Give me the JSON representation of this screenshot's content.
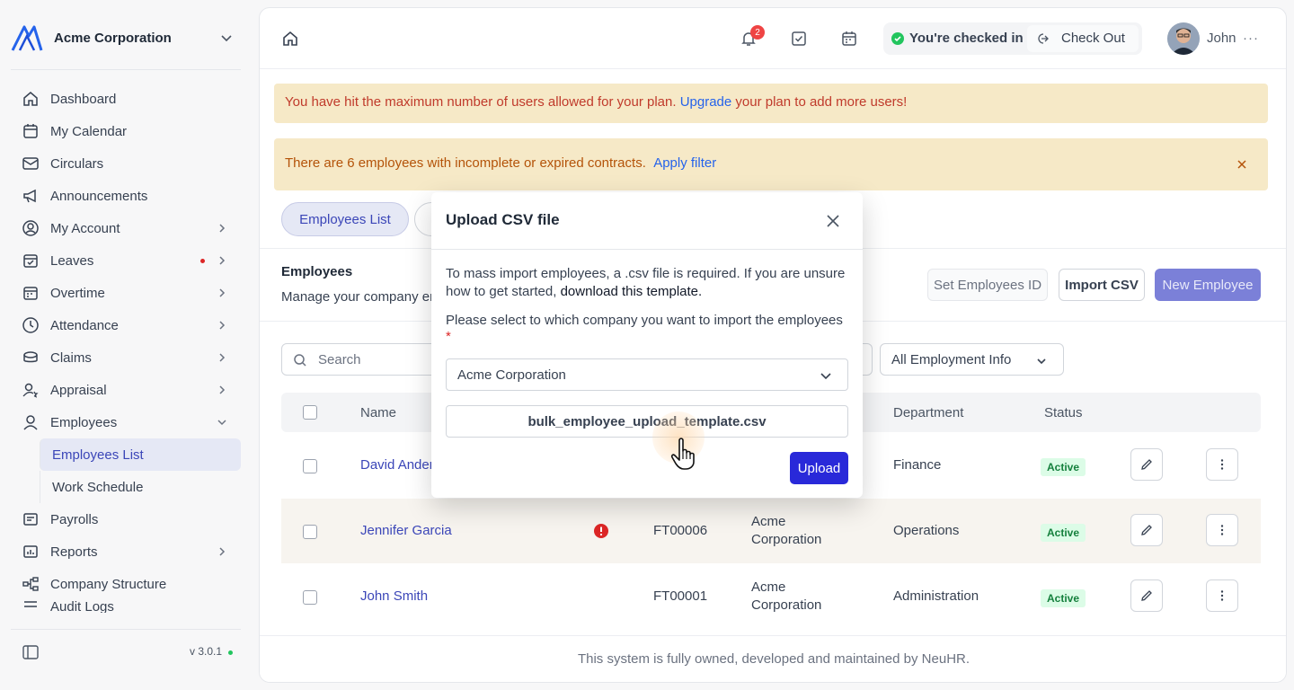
{
  "brand": {
    "name": "Acme Corporation"
  },
  "sidebar": {
    "items": [
      {
        "label": "Dashboard",
        "icon": "home-icon"
      },
      {
        "label": "My Calendar",
        "icon": "calendar-icon"
      },
      {
        "label": "Circulars",
        "icon": "mail-icon"
      },
      {
        "label": "Announcements",
        "icon": "megaphone-icon"
      },
      {
        "label": "My Account",
        "icon": "user-circle-icon"
      },
      {
        "label": "Leaves",
        "icon": "calendar-check-icon"
      },
      {
        "label": "Overtime",
        "icon": "calendar-clock-icon"
      },
      {
        "label": "Attendance",
        "icon": "clock-icon"
      },
      {
        "label": "Claims",
        "icon": "coins-icon"
      },
      {
        "label": "Appraisal",
        "icon": "user-star-icon"
      },
      {
        "label": "Employees",
        "icon": "user-icon"
      },
      {
        "label": "Payrolls",
        "icon": "receipt-icon"
      },
      {
        "label": "Reports",
        "icon": "chart-icon"
      },
      {
        "label": "Company Structure",
        "icon": "hierarchy-icon"
      },
      {
        "label": "Audit Logs",
        "icon": "list-icon"
      }
    ],
    "employees_sub": [
      {
        "label": "Employees List",
        "active": true
      },
      {
        "label": "Work Schedule",
        "active": false
      }
    ],
    "version": "v 3.0.1"
  },
  "topbar": {
    "notification_count": "2",
    "checkin_status": "You're checked in",
    "checkout_label": "Check Out",
    "user_name": "John",
    "more": "···"
  },
  "alerts": {
    "limit_text": "You have hit the maximum number of users allowed for your plan. ",
    "limit_link": "Upgrade",
    "limit_tail": " your plan to add more users!",
    "contracts_text": "There are 6 employees with incomplete or expired contracts.",
    "contracts_link": "Apply filter"
  },
  "tabs": {
    "employees_list": "Employees List"
  },
  "employees": {
    "title": "Employees",
    "description": "Manage your company employees",
    "set_id_label": "Set Employees ID",
    "import_label": "Import CSV",
    "new_label": "New Employee"
  },
  "filters": {
    "search_placeholder": "Search",
    "employment_info": "All Employment Info"
  },
  "table": {
    "headers": {
      "name": "Name",
      "department": "Department",
      "status": "Status"
    },
    "rows": [
      {
        "name": "David Anderson",
        "id": "",
        "company_line1": "",
        "company_line2": "",
        "department": "Finance",
        "status": "Active"
      },
      {
        "name": "Jennifer Garcia",
        "id": "FT00006",
        "company_line1": "Acme",
        "company_line2": "Corporation",
        "department": "Operations",
        "status": "Active"
      },
      {
        "name": "John Smith",
        "id": "FT00001",
        "company_line1": "Acme",
        "company_line2": "Corporation",
        "department": "Administration",
        "status": "Active"
      }
    ]
  },
  "footer": {
    "text": "This system is fully owned, developed and maintained by NeuHR."
  },
  "modal": {
    "title": "Upload CSV file",
    "intro": "To mass import employees, a .csv file is required. If you are unsure how to get started, ",
    "download_link": "download this template.",
    "select_prompt": "Please select to which company you want to import the employees",
    "required_mark": "*",
    "company_value": "Acme Corporation",
    "file_name": "bulk_employee_upload_template.csv",
    "upload_label": "Upload"
  },
  "colors": {
    "primary": "#3b46b8",
    "upload_button": "#2929d9",
    "alert_bg": "#f6e9c7",
    "active_badge": "#15803d"
  }
}
